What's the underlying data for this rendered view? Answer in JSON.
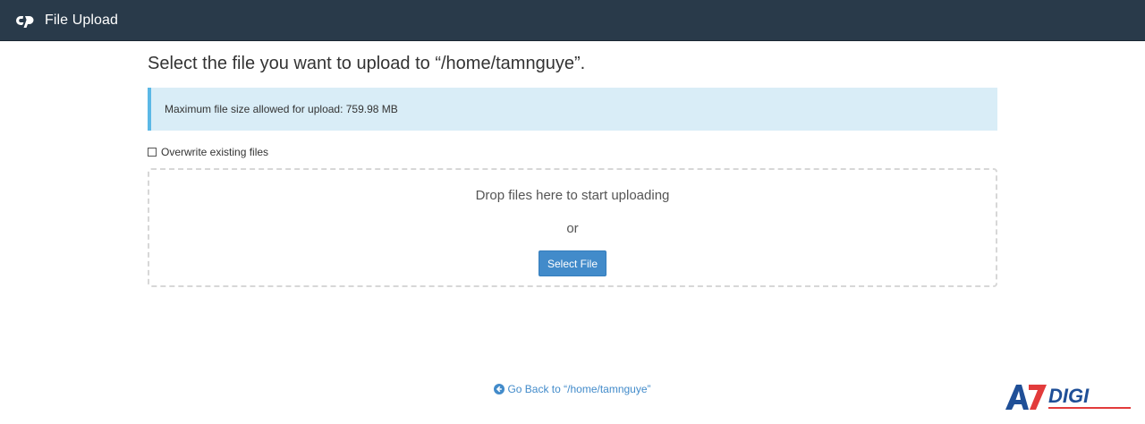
{
  "header": {
    "app_title": "File Upload",
    "logo_icon": "cpanel-logo-icon"
  },
  "main": {
    "title": "Select the file you want to upload to “/home/tamnguye”.",
    "info": "Maximum file size allowed for upload: 759.98 MB",
    "overwrite_label": "Overwrite existing files",
    "overwrite_checked": false,
    "dropzone": {
      "text": "Drop files here to start uploading",
      "or": "or",
      "select_button": "Select File"
    }
  },
  "footer": {
    "go_back": "Go Back to “/home/tamnguye”",
    "go_back_icon": "arrow-circle-left-icon"
  },
  "watermark": {
    "text": "A7DIGI"
  },
  "colors": {
    "topbar": "#293a4a",
    "info_bg": "#d9edf7",
    "info_border": "#5bb8e6",
    "button": "#428bca",
    "link": "#428bca"
  }
}
